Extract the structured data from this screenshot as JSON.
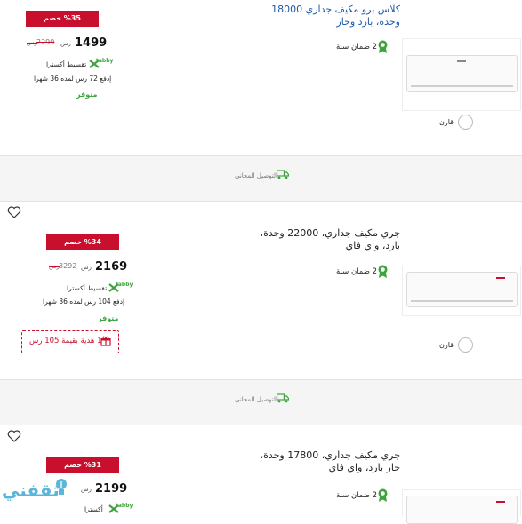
{
  "products": [
    {
      "title_line1": "كلاس برو مكيف جداري 18000",
      "title_line2": "وحدة، بارد وحار",
      "discount": "%35 خصم",
      "price": "1499",
      "currency": "رس",
      "old_price": "2299",
      "old_currency": "رس",
      "install_brand": "تقسيط أكسترا",
      "monthly": "إدفع 72 رس لمده 36 شهرا",
      "availability": "متوفر",
      "warranty": "2 ضمان سنة",
      "compare": "قارن"
    },
    {
      "title_line1": "جري مكيف جداري، 22000 وحدة،",
      "title_line2": "بارد، واي فاي",
      "discount": "%34 خصم",
      "price": "2169",
      "currency": "رس",
      "old_price": "3292",
      "old_currency": "رس",
      "install_brand": "تقسيط أكسترا",
      "monthly": "إدفع 104 رس لمده 36 شهرا",
      "availability": "متوفر",
      "gift": "1 هدية بقيمة 105 رس",
      "warranty": "2 ضمان سنة",
      "compare": "قارن"
    },
    {
      "title_line1": "جري مكيف جداري، 17800 وحدة،",
      "title_line2": "حار بارد، واي فاي",
      "discount": "%31 خصم",
      "price": "2199",
      "currency": "رس",
      "install_brand": "أكسترا",
      "warranty": "2 ضمان سنة"
    }
  ],
  "free_delivery": "التوصيل المجاني",
  "tabby_word": "tabby",
  "watermark": "ثقفني",
  "colors": {
    "accent_red": "#c8102e",
    "green": "#3fa33f",
    "link_blue": "#1f5aa8"
  }
}
